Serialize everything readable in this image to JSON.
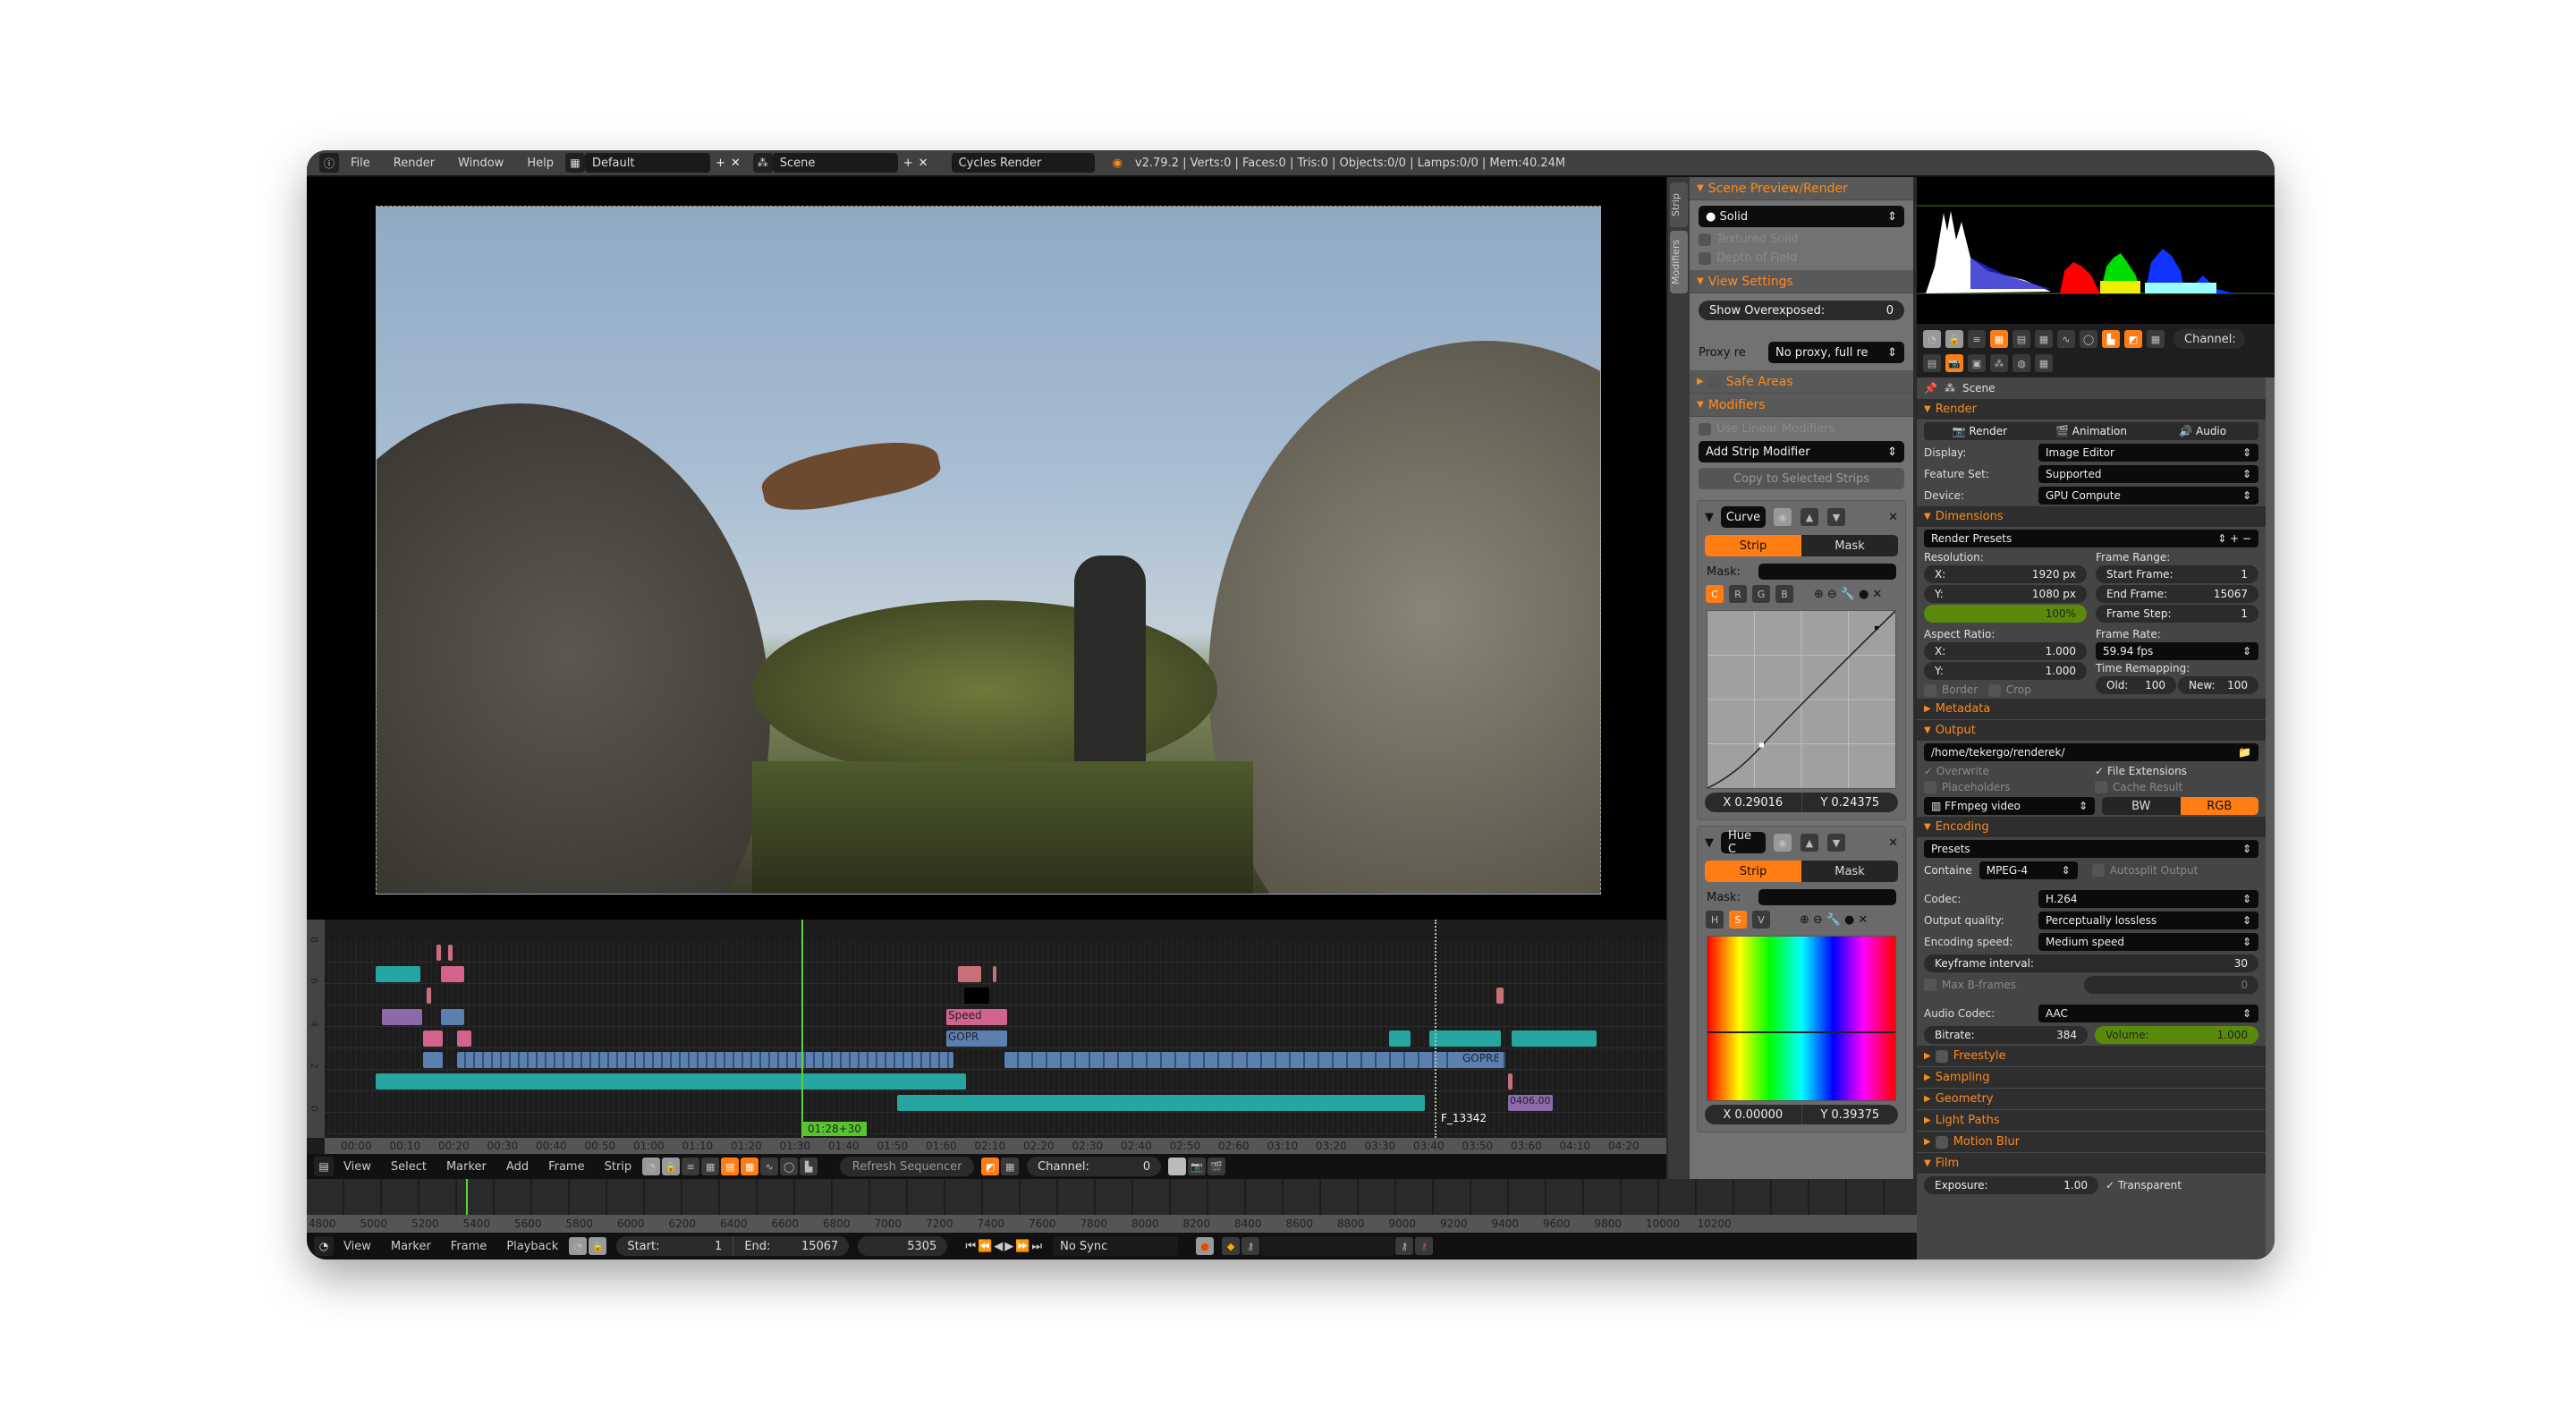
{
  "topbar": {
    "menu": [
      "File",
      "Render",
      "Window",
      "Help"
    ],
    "layout": "Default",
    "scene": "Scene",
    "engine": "Cycles Render",
    "stats": "v2.79.2 | Verts:0 | Faces:0 | Tris:0 | Objects:0/0 | Lamps:0/0 | Mem:40.24M"
  },
  "mid_tabs": [
    "Strip",
    "Modifiers"
  ],
  "mid_panel": {
    "scene_preview": {
      "title": "Scene Preview/Render",
      "shading": "Solid",
      "textured_solid": "Textured Solid",
      "depth_of_field": "Depth of Field"
    },
    "view_settings": {
      "title": "View Settings",
      "show_overexposed_label": "Show Overexposed:",
      "show_overexposed_value": "0",
      "proxy_label": "Proxy re",
      "proxy_value": "No proxy, full re"
    },
    "safe_areas": "Safe Areas",
    "modifiers": {
      "title": "Modifiers",
      "use_linear": "Use Linear Modifiers",
      "add": "Add Strip Modifier",
      "copy": "Copy to Selected Strips",
      "items": [
        {
          "name": "Curve",
          "tabs": [
            "Strip",
            "Mask"
          ],
          "mask_label": "Mask:",
          "channels": [
            "C",
            "R",
            "G",
            "B"
          ],
          "active_channel": "C",
          "x": "X 0.29016",
          "y": "Y 0.24375"
        },
        {
          "name": "Hue C",
          "tabs": [
            "Strip",
            "Mask"
          ],
          "mask_label": "Mask:",
          "channels": [
            "H",
            "S",
            "V"
          ],
          "active_channel": "S",
          "x": "X 0.00000",
          "y": "Y 0.39375"
        }
      ]
    }
  },
  "right_header": {
    "channel_label": "Channel:"
  },
  "right_panel": {
    "context": "Scene",
    "render": {
      "title": "Render",
      "tabs": [
        "Render",
        "Animation",
        "Audio"
      ],
      "display_label": "Display:",
      "display_value": "Image Editor",
      "feature_label": "Feature Set:",
      "feature_value": "Supported",
      "device_label": "Device:",
      "device_value": "GPU Compute"
    },
    "dimensions": {
      "title": "Dimensions",
      "presets": "Render Presets",
      "resolution_label": "Resolution:",
      "res_x_label": "X:",
      "res_x": "1920 px",
      "res_y_label": "Y:",
      "res_y": "1080 px",
      "res_pct": "100%",
      "frame_range_label": "Frame Range:",
      "start_label": "Start Frame:",
      "start": "1",
      "end_label": "End Frame:",
      "end": "15067",
      "step_label": "Frame Step:",
      "step": "1",
      "aspect_label": "Aspect Ratio:",
      "asp_x": "1.000",
      "asp_y": "1.000",
      "frame_rate_label": "Frame Rate:",
      "frame_rate": "59.94 fps",
      "remap_label": "Time Remapping:",
      "old_label": "Old:",
      "old": "100",
      "new_label": "New:",
      "new": "100",
      "border": "Border",
      "crop": "Crop"
    },
    "metadata": "Metadata",
    "output": {
      "title": "Output",
      "path": "/home/tekergo/renderek/",
      "overwrite": "Overwrite",
      "file_ext": "File Extensions",
      "placeholders": "Placeholders",
      "cache": "Cache Result",
      "format": "FFmpeg video",
      "bw": "BW",
      "rgb": "RGB"
    },
    "encoding": {
      "title": "Encoding",
      "presets": "Presets",
      "container_label": "Containe",
      "container": "MPEG-4",
      "autosplit": "Autosplit Output",
      "codec_label": "Codec:",
      "codec": "H.264",
      "quality_label": "Output quality:",
      "quality": "Perceptually lossless",
      "speed_label": "Encoding speed:",
      "speed": "Medium speed",
      "keyframe_label": "Keyframe interval:",
      "keyframe": "30",
      "bframes_label": "Max B-frames",
      "bframes": "0",
      "audio_codec_label": "Audio Codec:",
      "audio_codec": "AAC",
      "bitrate_label": "Bitrate:",
      "bitrate": "384",
      "volume_label": "Volume:",
      "volume": "1.000"
    },
    "collapsed": [
      "Freestyle",
      "Sampling",
      "Geometry",
      "Light Paths",
      "Motion Blur"
    ],
    "film": {
      "title": "Film",
      "exposure_label": "Exposure:",
      "exposure": "1.00",
      "transparent": "Transparent"
    }
  },
  "sequencer": {
    "channel_numbers": [
      "8",
      "6",
      "4",
      "2",
      "0"
    ],
    "ruler": [
      "00:00",
      "00:10",
      "00:20",
      "00:30",
      "00:40",
      "00:50",
      "01:00",
      "01:10",
      "01:20",
      "01:30",
      "01:40",
      "01:50",
      "01:60",
      "02:10",
      "02:20",
      "02:30",
      "02:40",
      "02:50",
      "02:60",
      "03:10",
      "03:20",
      "03:30",
      "03:40",
      "03:50",
      "03:60",
      "04:10",
      "04:20"
    ],
    "current_time": "01:28+30",
    "marker_label": "F_13342",
    "strip_labels": {
      "speed": "Speed",
      "gopr": "GOPR",
      "gopr2": "GOPR8",
      "sound": "0406.00"
    },
    "menu": [
      "View",
      "Select",
      "Marker",
      "Add",
      "Frame",
      "Strip"
    ],
    "refresh": "Refresh Sequencer",
    "channel_label": "Channel:",
    "channel_value": "0"
  },
  "timeline": {
    "ruler": [
      "4800",
      "5000",
      "5200",
      "5400",
      "5600",
      "5800",
      "6000",
      "6200",
      "6400",
      "6600",
      "6800",
      "7000",
      "7200",
      "7400",
      "7600",
      "7800",
      "8000",
      "8200",
      "8400",
      "8600",
      "8800",
      "9000",
      "9200",
      "9400",
      "9600",
      "9800",
      "10000",
      "10200"
    ],
    "menu": [
      "View",
      "Marker",
      "Frame",
      "Playback"
    ],
    "start_label": "Start:",
    "start": "1",
    "end_label": "End:",
    "end": "15067",
    "current": "5305",
    "sync": "No Sync"
  }
}
